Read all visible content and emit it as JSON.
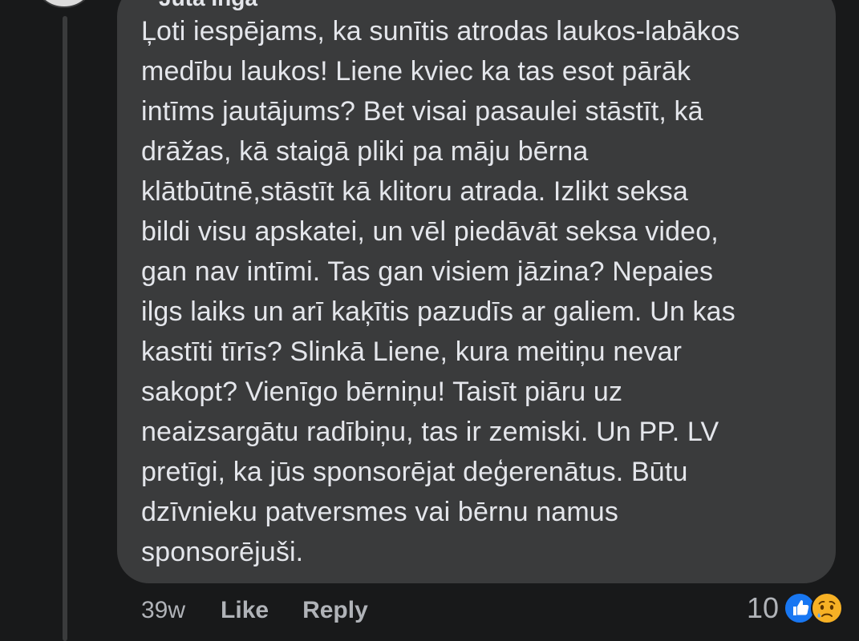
{
  "comment": {
    "author": "Jūta Inga",
    "text_lines": [
      "Ļoti iespējams, ka sunītis atrodas laukos-labākos",
      "medību laukos! Liene kviec ka tas esot pārāk",
      "intīms jautājums? Bet visai pasaulei stāstīt, kā",
      "drāžas, kā staigā pliki pa māju bērna",
      "klātbūtnē,stāstīt kā klitoru atrada. Izlikt seksa",
      "bildi visu apskatei, un vēl piedāvāt seksa video,",
      "gan nav intīmi. Tas gan visiem jāzina? Nepaies",
      "ilgs laiks un arī kaķītis pazudīs ar galiem. Un kas",
      "kastīti tīrīs? Slinkā Liene, kura meitiņu nevar",
      "sakopt? Vienīgo bērniņu! Taisīt piāru uz",
      "neaizsargātu radībiņu, tas ir zemiski. Un PP. LV",
      "pretīgi, ka jūs sponsorējat deģerenātus. Būtu",
      "dzīvnieku patversmes vai bērnu namus",
      "sponsorējuši."
    ]
  },
  "actions": {
    "time": "39w",
    "like_label": "Like",
    "reply_label": "Reply"
  },
  "reactions": {
    "count": "10",
    "icons": [
      "like-reaction-icon",
      "sad-reaction-icon"
    ],
    "colors": {
      "like": "#1877f2",
      "sad": "#f7b125"
    }
  },
  "theme": {
    "background": "#18191a",
    "bubble": "#3a3b3c",
    "text": "#e4e6eb",
    "secondary_text": "#b0b3b8"
  }
}
